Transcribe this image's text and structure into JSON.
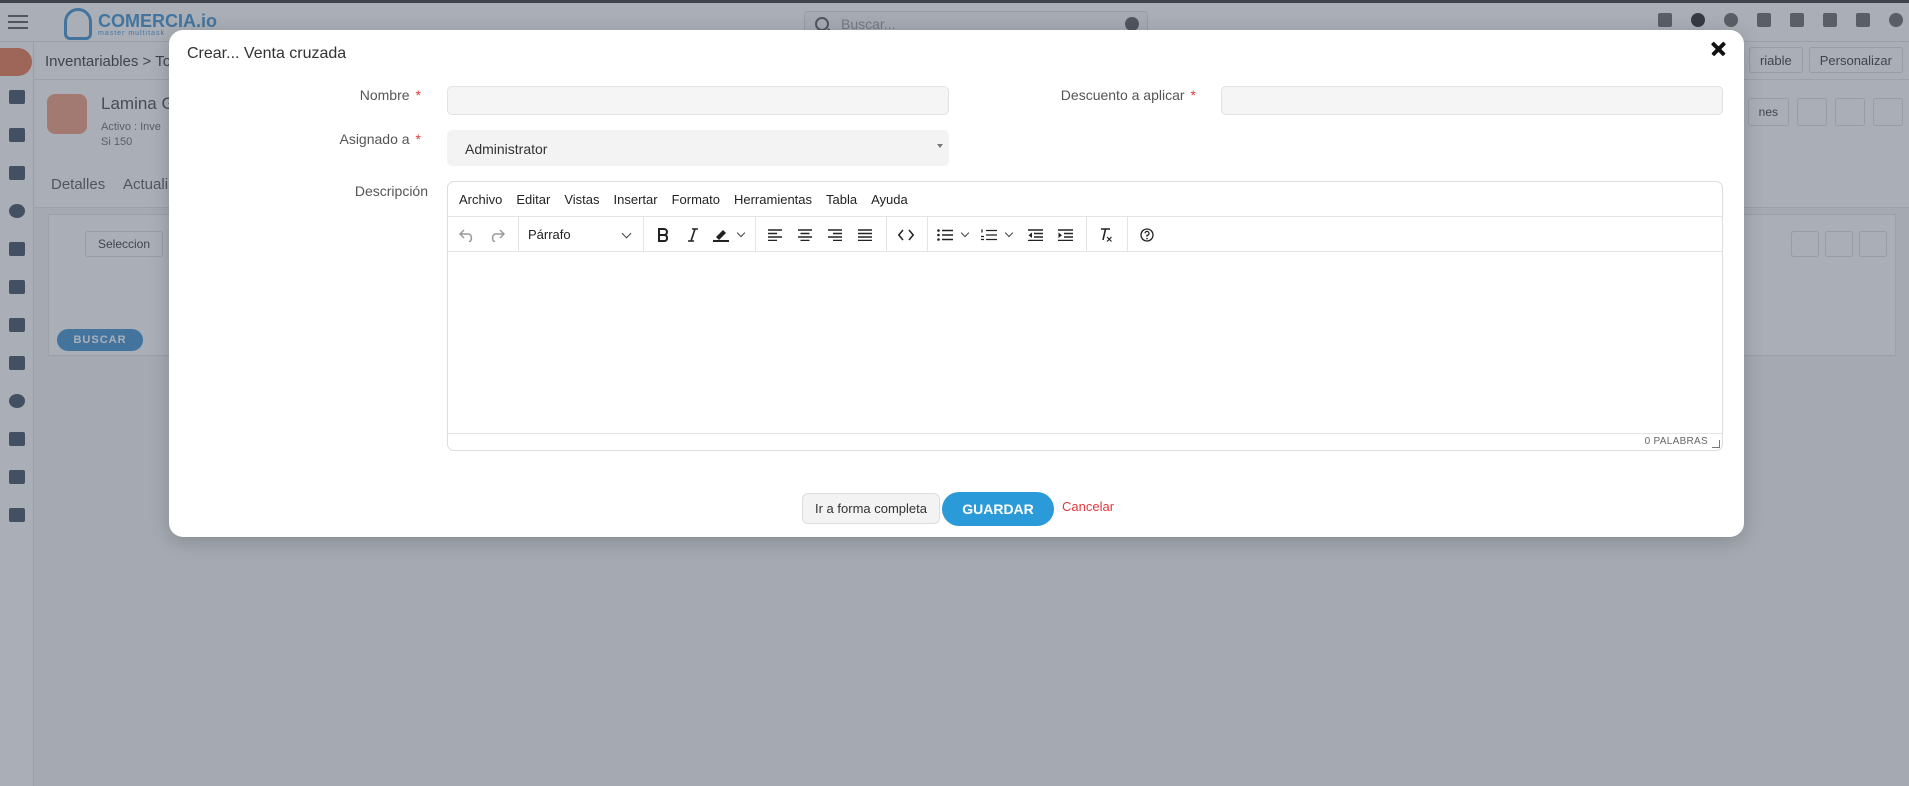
{
  "app": {
    "logo_text": "COMERCIA.io",
    "logo_subtitle": "master multitask",
    "search_placeholder": "Buscar..."
  },
  "breadcrumb": {
    "text": "Inventariables  >  To"
  },
  "header_buttons": {
    "variable": "riable",
    "personalize": "Personalizar"
  },
  "record": {
    "name": "Lamina G",
    "meta_line1": "Activo :   Inve",
    "meta_line2": "Si            150",
    "actions_label": "nes"
  },
  "tabs": {
    "details": "Detalles",
    "updates": "Actuali"
  },
  "panel": {
    "select_label": "Seleccion",
    "search_button": "BUSCAR"
  },
  "modal": {
    "title": "Crear... Venta cruzada",
    "fields": {
      "name": {
        "label": "Nombre",
        "value": "",
        "required": "*"
      },
      "discount": {
        "label": "Descuento a aplicar",
        "value": "",
        "required": "*"
      },
      "assigned": {
        "label": "Asignado a",
        "value": "Administrator",
        "required": "*"
      },
      "description": {
        "label": "Descripción"
      }
    },
    "editor": {
      "menu": [
        "Archivo",
        "Editar",
        "Vistas",
        "Insertar",
        "Formato",
        "Herramientas",
        "Tabla",
        "Ayuda"
      ],
      "block_format": "Párrafo",
      "word_count": "0 PALABRAS",
      "icons": [
        "undo-icon",
        "redo-icon",
        "bold-icon",
        "italic-icon",
        "highlight-icon",
        "align-left-icon",
        "align-center-icon",
        "align-right-icon",
        "align-justify-icon",
        "code-icon",
        "bullet-list-icon",
        "numbered-list-icon",
        "outdent-icon",
        "indent-icon",
        "clear-format-icon",
        "help-icon"
      ]
    },
    "buttons": {
      "full_form": "Ir a forma completa",
      "save": "GUARDAR",
      "cancel": "Cancelar"
    }
  },
  "colors": {
    "primary": "#2a9ad8",
    "danger": "#e0393e",
    "brand_orange": "#e8734a",
    "overlay": "#4e5868"
  }
}
